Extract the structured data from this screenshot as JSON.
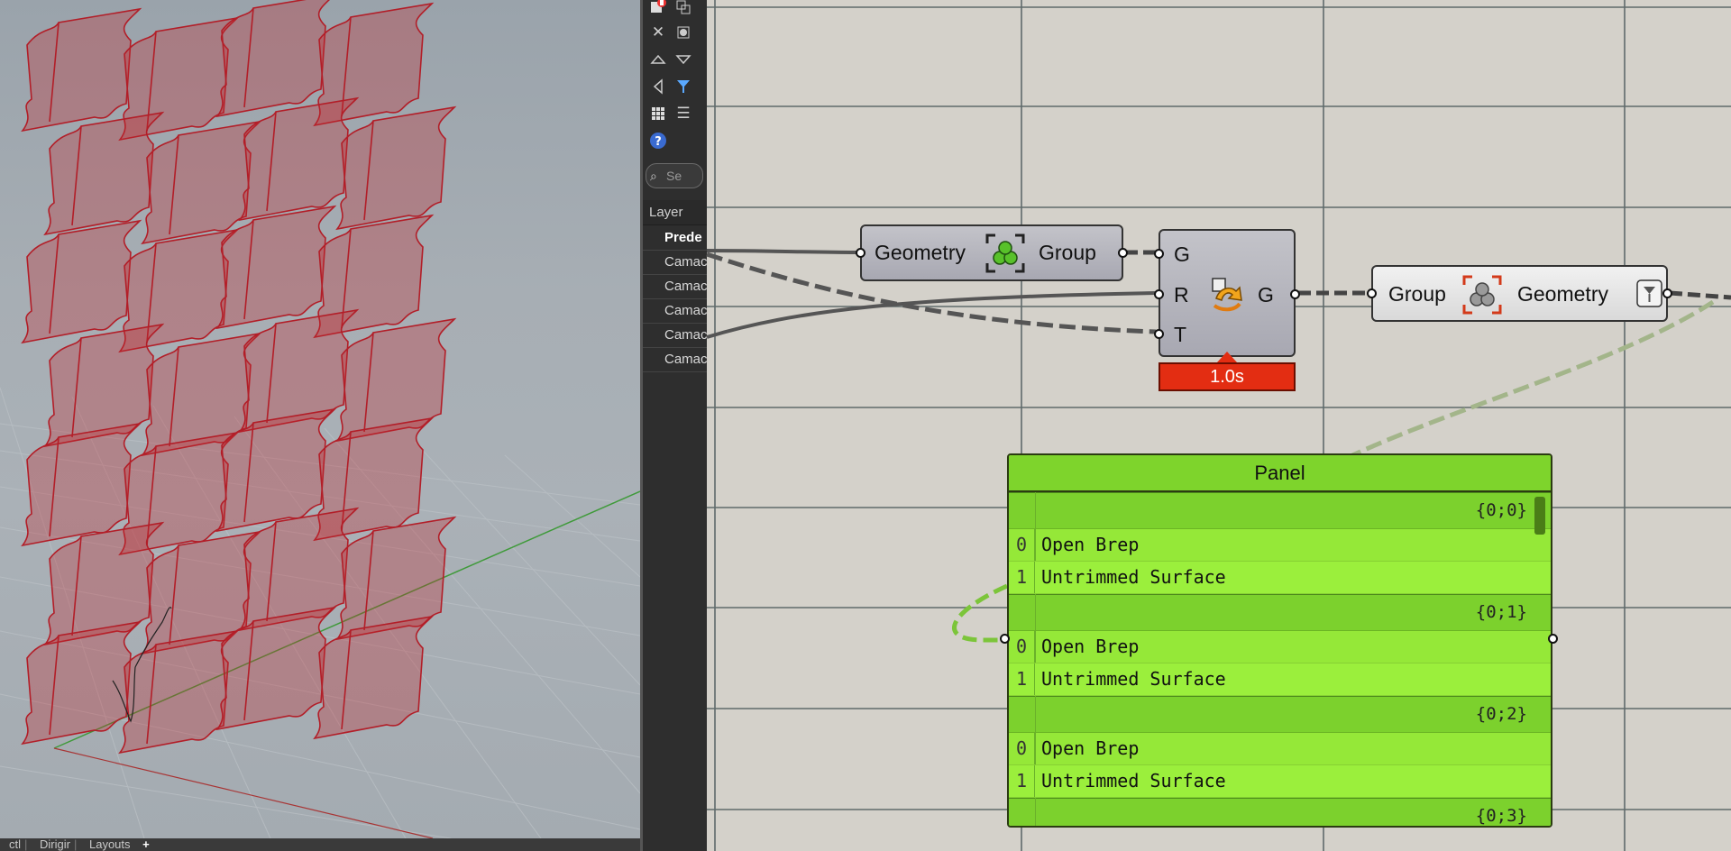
{
  "viewport": {
    "tabs": [
      "ctl",
      "Dirigir",
      "Layouts"
    ],
    "add_tab_symbol": "+"
  },
  "side_panel": {
    "toolbar_icons": [
      "new-layer-icon",
      "new-sublayer-icon",
      "delete-icon",
      "filter-icon",
      "move-up-icon",
      "move-down-icon",
      "move-left-icon",
      "funnel-icon",
      "grid-view-icon",
      "list-view-icon",
      "help-icon"
    ],
    "search_placeholder": "Se",
    "layer_header": "Layer",
    "layers": [
      "Prede",
      "Camac",
      "Camac",
      "Camac",
      "Camac",
      "Camac"
    ]
  },
  "grasshopper": {
    "group_component": {
      "input_label": "Geometry",
      "output_label": "Group"
    },
    "transform_component": {
      "inputs": [
        "G",
        "R",
        "T"
      ],
      "output": "G",
      "timer": "1.0s"
    },
    "ungroup_component": {
      "input_label": "Group",
      "output_label": "Geometry"
    },
    "panel": {
      "title": "Panel",
      "branches": [
        {
          "path": "{0;0}",
          "items": [
            {
              "index": "0",
              "text": "Open Brep"
            },
            {
              "index": "1",
              "text": "Untrimmed Surface"
            }
          ]
        },
        {
          "path": "{0;1}",
          "items": [
            {
              "index": "0",
              "text": "Open Brep"
            },
            {
              "index": "1",
              "text": "Untrimmed Surface"
            }
          ]
        },
        {
          "path": "{0;2}",
          "items": [
            {
              "index": "0",
              "text": "Open Brep"
            },
            {
              "index": "1",
              "text": "Untrimmed Surface"
            }
          ]
        },
        {
          "path": "{0;3}"
        }
      ]
    },
    "colors": {
      "canvas": "#d4d1ca",
      "panel_fill": "#95e838",
      "timer": "#e32d12",
      "geometry_red": "#c0282e"
    }
  }
}
